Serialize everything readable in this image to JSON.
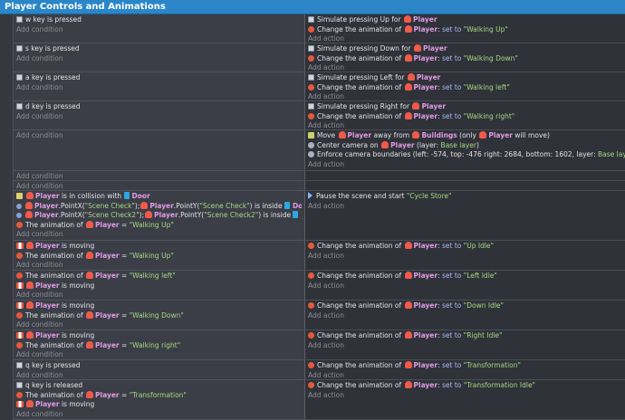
{
  "group_title": "Player Controls and Animations",
  "add_condition": "Add condition",
  "add_action": "Add action",
  "events": [
    {
      "conds": [
        "w key is pressed"
      ],
      "acts": [
        "Simulate pressing Up for Player",
        "Change the animation of Player: set to \"Walking Up\""
      ]
    },
    {
      "conds": [
        "s key is pressed"
      ],
      "acts": [
        "Simulate pressing Down for Player",
        "Change the animation of Player: set to \"Walking Down\""
      ]
    },
    {
      "conds": [
        "a key is pressed"
      ],
      "acts": [
        "Simulate pressing Left for Player",
        "Change the animation of Player: set to \"Walking left\""
      ]
    },
    {
      "conds": [
        "d key is pressed"
      ],
      "acts": [
        "Simulate pressing Right for Player",
        "Change the animation of Player: set to \"Walking right\""
      ]
    },
    {
      "conds": [],
      "acts": [
        "Move Player away from Buildings (only Player will move)",
        "Center camera on Player (layer: Base layer)",
        "Enforce camera boundaries (left: -574, top: -476 right: 2684, bottom: 1602, layer: Base layer)"
      ]
    },
    {
      "conds": [],
      "acts": []
    },
    {
      "conds": [],
      "acts": []
    },
    {
      "conds": [
        "Player is in collision with Door",
        "Player.PointX(\"Scene Check\");Player.PointY(\"Scene Check\") is inside Door",
        "Player.PointX(\"Scene Check2\");Player.PointY(\"Scene Check2\") is inside Door",
        "The animation of Player = \"Walking Up\""
      ],
      "acts": [
        "Pause the scene and start \"Cycle Store\""
      ]
    },
    {
      "conds": [
        "Player is moving",
        "The animation of Player = \"Walking Up\""
      ],
      "acts": [
        "Change the animation of Player: set to \"Up Idle\""
      ]
    },
    {
      "conds": [
        "The animation of Player = \"Walking left\"",
        "Player is moving"
      ],
      "acts": [
        "Change the animation of Player: set to \"Left Idle\""
      ]
    },
    {
      "conds": [
        "Player is moving",
        "The animation of Player = \"Walking Down\""
      ],
      "acts": [
        "Change the animation of Player: set to \"Down Idle\""
      ]
    },
    {
      "conds": [
        "Player is moving",
        "The animation of Player = \"Walking right\""
      ],
      "acts": [
        "Change the animation of Player: set to \"Right Idle\""
      ]
    },
    {
      "conds": [
        "q key is pressed"
      ],
      "acts": [
        "Change the animation of Player: set to \"Transformation\""
      ]
    },
    {
      "conds": [
        "q key is released",
        "The animation of Player = \"Transformation\"",
        "Player is moving"
      ],
      "acts": [
        "Change the animation of Player: set to \"Transformation Idle\""
      ]
    }
  ]
}
